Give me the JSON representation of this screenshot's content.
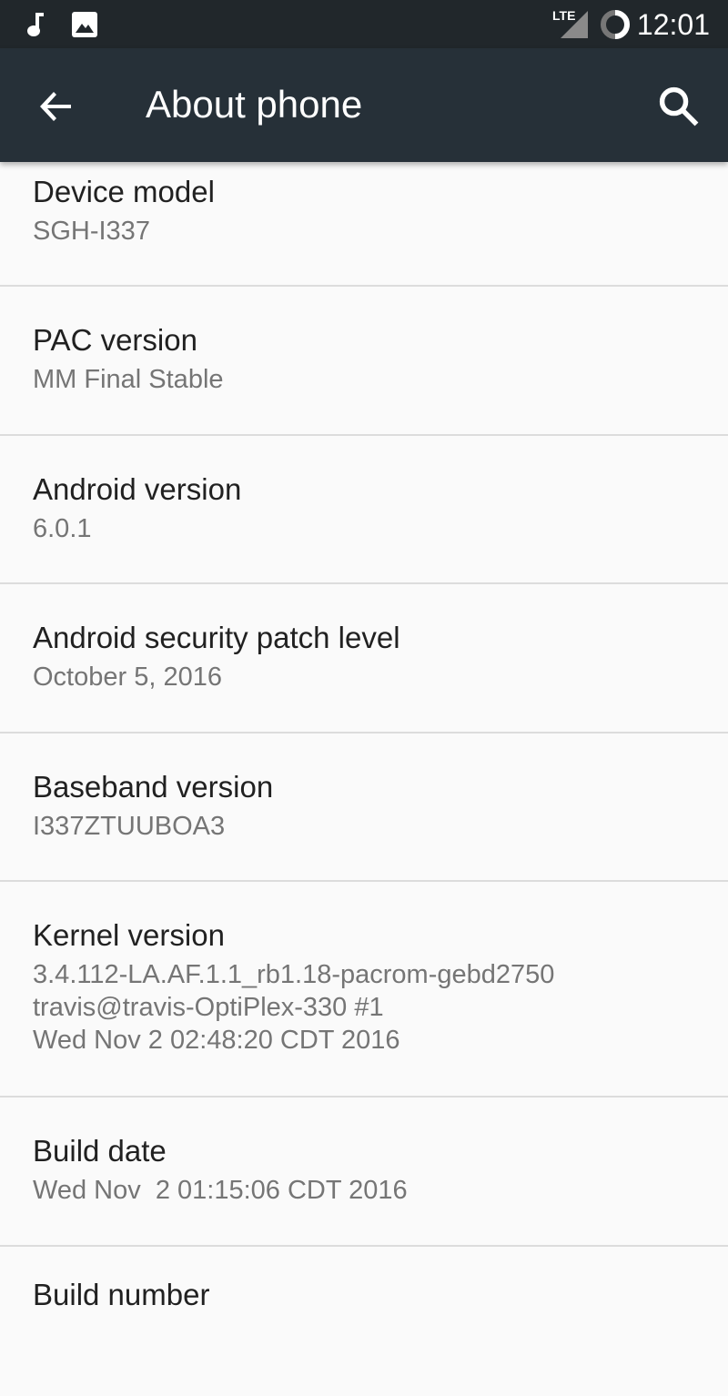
{
  "status_bar": {
    "left_icons": [
      "music-note-icon",
      "image-icon"
    ],
    "network": "LTE",
    "time": "12:01"
  },
  "app_bar": {
    "title": "About phone",
    "back_icon": "arrow-back-icon",
    "search_icon": "search-icon"
  },
  "items": [
    {
      "title": "Device model",
      "summary": [
        "SGH-I337"
      ]
    },
    {
      "title": "PAC version",
      "summary": [
        "MM Final Stable"
      ]
    },
    {
      "title": "Android version",
      "summary": [
        "6.0.1"
      ]
    },
    {
      "title": "Android security patch level",
      "summary": [
        "October 5, 2016"
      ]
    },
    {
      "title": "Baseband version",
      "summary": [
        "I337ZTUUBOA3"
      ]
    },
    {
      "title": "Kernel version",
      "summary": [
        "3.4.112-LA.AF.1.1_rb1.18-pacrom-gebd2750",
        "travis@travis-OptiPlex-330 #1",
        "Wed Nov 2 02:48:20 CDT 2016"
      ]
    },
    {
      "title": "Build date",
      "summary": [
        "Wed Nov  2 01:15:06 CDT 2016"
      ]
    },
    {
      "title": "Build number",
      "summary": []
    }
  ]
}
